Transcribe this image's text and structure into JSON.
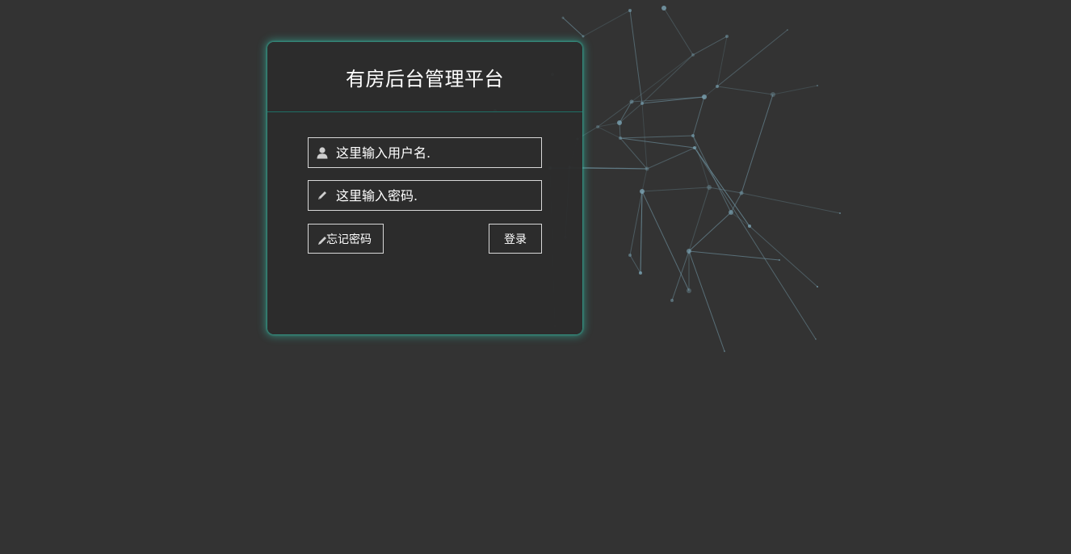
{
  "login": {
    "title": "有房后台管理平台",
    "username": {
      "placeholder": "这里输入用户名.",
      "value": "",
      "icon": "user-icon"
    },
    "password": {
      "placeholder": "这里输入密码.",
      "value": "",
      "icon": "pencil-icon"
    },
    "forgot_label": "忘记密码",
    "forgot_icon": "pencil-icon",
    "login_label": "登录"
  },
  "colors": {
    "background": "#333333",
    "panel": "#2c2c2c",
    "glow": "#36c8af",
    "network_line": "#6d8f9c",
    "network_node": "#7aa3b3",
    "text": "#ffffff"
  }
}
